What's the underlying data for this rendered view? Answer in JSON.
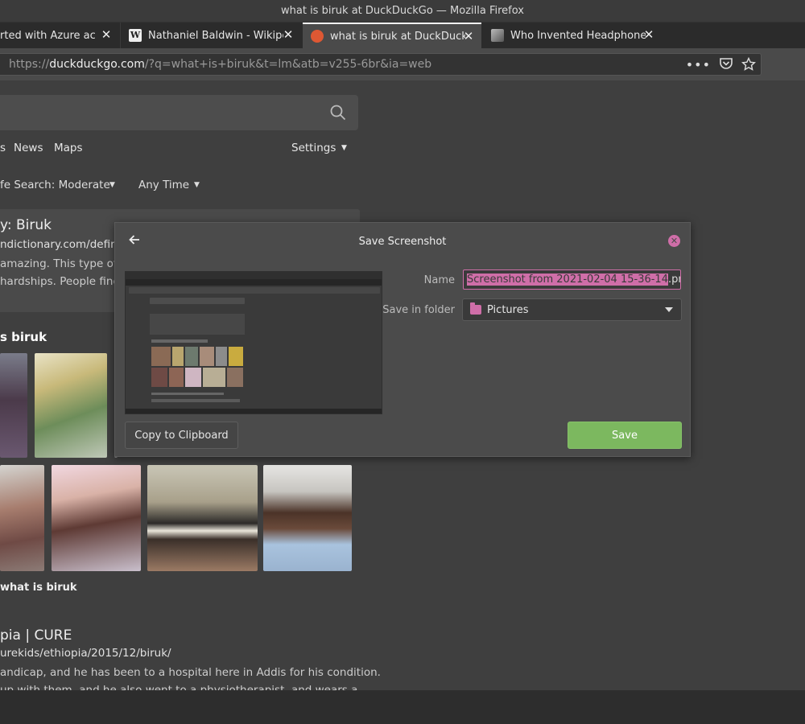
{
  "window": {
    "title": "what is biruk at DuckDuckGo — Mozilla Firefox"
  },
  "tabs": [
    {
      "label": "rted with Azure acco",
      "active": false
    },
    {
      "label": "Nathaniel Baldwin - Wikipe",
      "active": false
    },
    {
      "label": "what is biruk at DuckDuckG",
      "active": true
    },
    {
      "label": "Who Invented Headphones",
      "active": false
    }
  ],
  "tab_close_glyph": "✕",
  "new_tab_glyph": "+",
  "url": {
    "prefix": "https://",
    "host": "duckduckgo.com",
    "rest": "/?q=what+is+biruk&t=lm&atb=v255-6br&ia=web"
  },
  "url_icons": [
    "more-icon",
    "pocket-icon",
    "star-icon"
  ],
  "nav": {
    "news": "News",
    "maps": "Maps",
    "settings": "Settings",
    "cut_item": "s"
  },
  "filters": {
    "safe_search": "fe Search: Moderate",
    "time": "Any Time"
  },
  "result1": {
    "title": "y: Biruk",
    "url": "ndictionary.com/define.",
    "snippet1": "amazing. This type of p",
    "snippet2": " hardships. People finc"
  },
  "images_heading": "s biruk",
  "more_images": "what is biruk",
  "result2": {
    "title": "pia | CURE",
    "url": "urekids/ethiopia/2015/12/biruk/",
    "snippet1": "andicap, and he has been to a hospital here in Addis for his condition.",
    "snippet2": "up with them, and he also went to a physiotherapist, and wears a"
  },
  "dialog": {
    "title": "Save Screenshot",
    "name_label": "Name",
    "name_selected": "Screenshot from 2021-02-04 15-36-14",
    "name_ext": ".png",
    "folder_label": "Save in folder",
    "folder_value": "Pictures",
    "copy_button": "Copy to Clipboard",
    "save_button": "Save"
  },
  "colors": {
    "accent": "#cf6ea8",
    "save_green": "#7cb85f"
  }
}
